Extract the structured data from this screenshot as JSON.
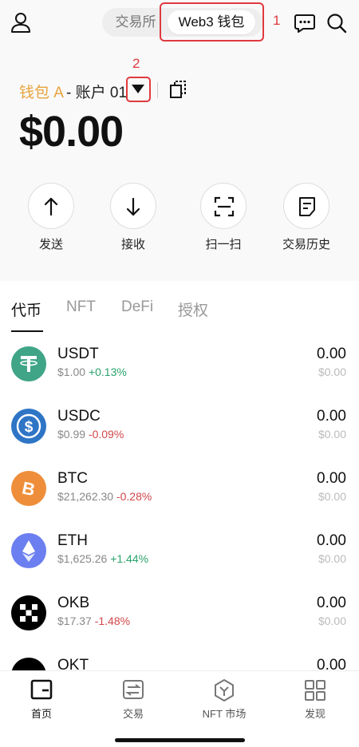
{
  "header": {
    "segments": {
      "exchange": "交易所",
      "web3": "Web3 钱包"
    },
    "annotation_1": "1",
    "annotation_2": "2",
    "icons": [
      "user-icon",
      "chat-icon",
      "search-icon"
    ]
  },
  "wallet": {
    "name": "钱包 A",
    "account": "- 账户 01",
    "balance": "$0.00"
  },
  "actions": [
    {
      "label": "发送",
      "icon": "arrow-up-icon"
    },
    {
      "label": "接收",
      "icon": "arrow-down-icon"
    },
    {
      "label": "扫一扫",
      "icon": "scan-icon"
    },
    {
      "label": "交易历史",
      "icon": "history-icon"
    }
  ],
  "tabs": [
    "代币",
    "NFT",
    "DeFi",
    "授权"
  ],
  "tokens": [
    {
      "symbol": "USDT",
      "price": "$1.00",
      "change": "+0.13%",
      "balance": "0.00",
      "usd": "$0.00",
      "color": "#3fa586"
    },
    {
      "symbol": "USDC",
      "price": "$0.99",
      "change": "-0.09%",
      "balance": "0.00",
      "usd": "$0.00",
      "color": "#2f75c6"
    },
    {
      "symbol": "BTC",
      "price": "$21,262.30",
      "change": "-0.28%",
      "balance": "0.00",
      "usd": "$0.00",
      "color": "#ef8e3a"
    },
    {
      "symbol": "ETH",
      "price": "$1,625.26",
      "change": "+1.44%",
      "balance": "0.00",
      "usd": "$0.00",
      "color": "#6c7ff0"
    },
    {
      "symbol": "OKB",
      "price": "$17.37",
      "change": "-1.48%",
      "balance": "0.00",
      "usd": "$0.00",
      "color": "#000000"
    },
    {
      "symbol": "OKT",
      "price": "",
      "change": "",
      "balance": "0.00",
      "usd": "",
      "color": "#000000"
    }
  ],
  "nav": [
    {
      "label": "首页",
      "icon": "wallet-icon"
    },
    {
      "label": "交易",
      "icon": "trade-icon"
    },
    {
      "label": "NFT 市场",
      "icon": "nft-icon"
    },
    {
      "label": "发现",
      "icon": "grid-icon"
    }
  ]
}
